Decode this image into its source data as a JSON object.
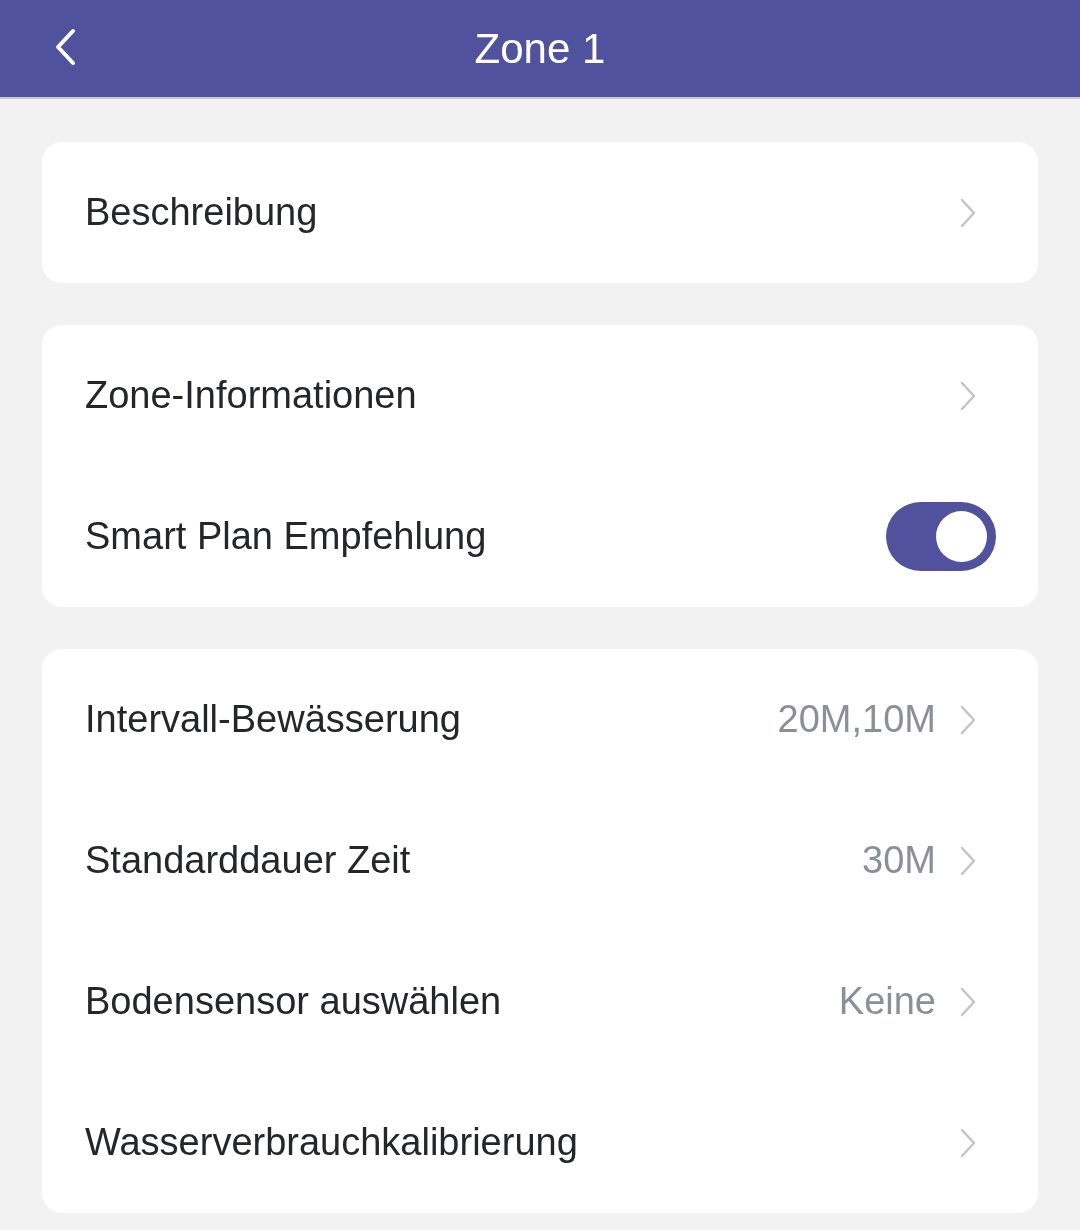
{
  "header": {
    "title": "Zone 1"
  },
  "sections": [
    {
      "items": [
        {
          "kind": "link",
          "label": "Beschreibung"
        }
      ]
    },
    {
      "items": [
        {
          "kind": "link",
          "label": "Zone-Informationen"
        },
        {
          "kind": "toggle",
          "label": "Smart Plan Empfehlung",
          "on": true
        }
      ]
    },
    {
      "items": [
        {
          "kind": "link",
          "label": "Intervall-Bewässerung",
          "value": "20M,10M"
        },
        {
          "kind": "link",
          "label": "Standarddauer Zeit",
          "value": "30M"
        },
        {
          "kind": "link",
          "label": "Bodensensor auswählen",
          "value": "Keine"
        },
        {
          "kind": "link",
          "label": "Wasserverbrauchkalibrierung"
        }
      ]
    }
  ]
}
